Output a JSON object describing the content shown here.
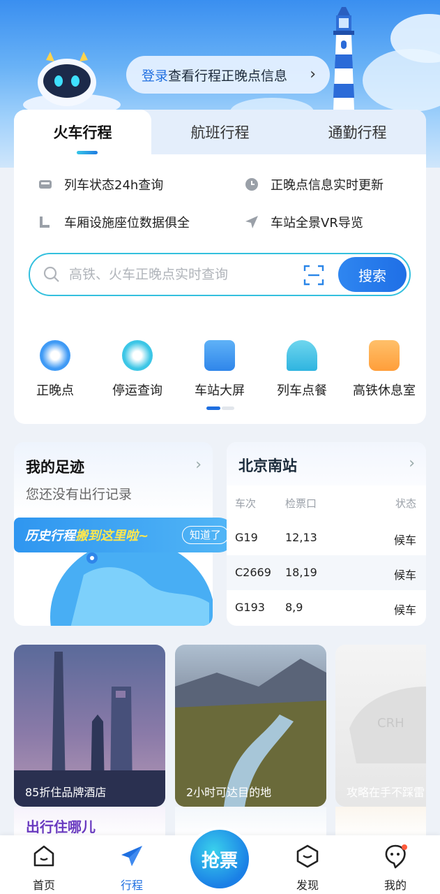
{
  "header": {
    "login_link": "登录",
    "login_rest": "查看行程正晚点信息"
  },
  "tabs": [
    {
      "label": "火车行程",
      "active": true
    },
    {
      "label": "航班行程",
      "active": false
    },
    {
      "label": "通勤行程",
      "active": false
    }
  ],
  "features": [
    {
      "icon": "train-icon",
      "label": "列车状态24h查询"
    },
    {
      "icon": "clock-icon",
      "label": "正晚点信息实时更新"
    },
    {
      "icon": "seat-icon",
      "label": "车厢设施座位数据俱全"
    },
    {
      "icon": "navigation-icon",
      "label": "车站全景VR导览"
    }
  ],
  "search": {
    "placeholder": "高铁、火车正晚点实时查询",
    "button": "搜索"
  },
  "quick_entries": [
    {
      "icon": "clock-icon",
      "label": "正晚点"
    },
    {
      "icon": "stop-icon",
      "label": "停运查询"
    },
    {
      "icon": "screen-icon",
      "label": "车站大屏"
    },
    {
      "icon": "dining-icon",
      "label": "列车点餐"
    },
    {
      "icon": "sofa-icon",
      "label": "高铁休息室"
    }
  ],
  "footprint": {
    "title": "我的足迹",
    "subtitle": "您还没有出行记录"
  },
  "history_banner": {
    "part1": "历史行程",
    "part2": "搬到这里啦~",
    "button": "知道了"
  },
  "station": {
    "name": "北京南站",
    "headers": [
      "车次",
      "检票口",
      "状态"
    ],
    "rows": [
      {
        "train": "G19",
        "gate": "12,13",
        "status": "候车"
      },
      {
        "train": "C2669",
        "gate": "18,19",
        "status": "候车"
      },
      {
        "train": "G193",
        "gate": "8,9",
        "status": "候车"
      }
    ]
  },
  "promos": [
    {
      "caption": "85折住品牌酒店"
    },
    {
      "caption": "2小时可达目的地"
    },
    {
      "caption": "攻略在手不踩雷"
    }
  ],
  "promo_bottom": {
    "stay": "出行住哪儿"
  },
  "tabbar": {
    "home": "首页",
    "trip": "行程",
    "grab": "抢票",
    "discover": "发现",
    "mine": "我的"
  },
  "colors": {
    "accent": "#1f6fe0",
    "teal": "#34c0de",
    "highlight": "#ffe74d"
  }
}
